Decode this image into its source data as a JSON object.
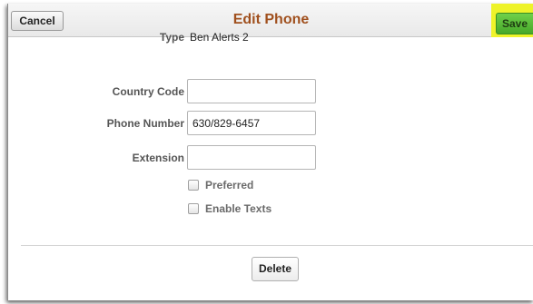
{
  "header": {
    "cancel_label": "Cancel",
    "title": "Edit Phone",
    "save_label": "Save"
  },
  "form": {
    "type": {
      "label": "Type",
      "value": "Ben Alerts 2"
    },
    "country_code": {
      "label": "Country Code",
      "value": ""
    },
    "phone_number": {
      "label": "Phone Number",
      "value": "630/829-6457"
    },
    "extension": {
      "label": "Extension",
      "value": ""
    },
    "preferred": {
      "label": "Preferred",
      "checked": false
    },
    "enable_texts": {
      "label": "Enable Texts",
      "checked": false
    }
  },
  "footer": {
    "delete_label": "Delete"
  },
  "colors": {
    "title": "#a0501e",
    "save_button": "#46a82a",
    "save_highlight": "#eef32a"
  }
}
